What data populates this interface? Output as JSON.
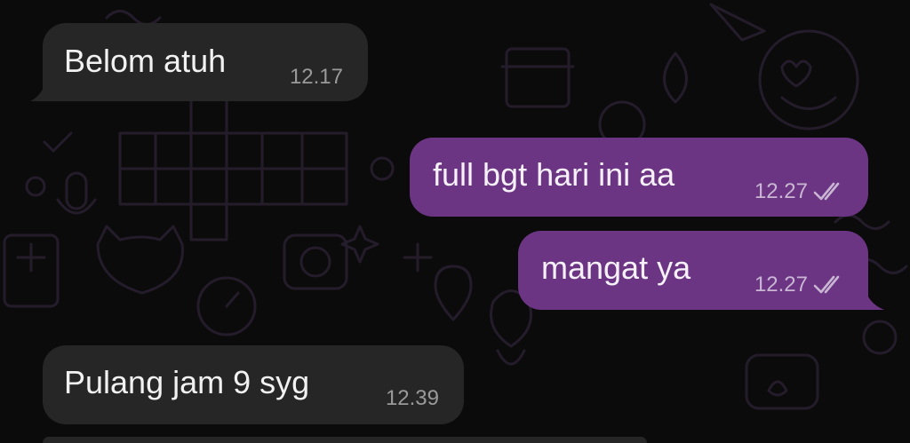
{
  "chat": {
    "messages": [
      {
        "direction": "incoming",
        "text": "Belom atuh",
        "time": "12.17"
      },
      {
        "direction": "outgoing",
        "text": "full bgt hari ini aa",
        "time": "12.27",
        "status_icon": "double-check-icon"
      },
      {
        "direction": "outgoing",
        "text": "mangat ya",
        "time": "12.27",
        "status_icon": "double-check-icon"
      },
      {
        "direction": "incoming",
        "text": "Pulang jam 9 syg",
        "time": "12.39"
      }
    ]
  },
  "colors": {
    "background": "#0b0b0b",
    "incoming_bubble": "#262626",
    "outgoing_bubble": "#6b3584",
    "doodle": "#3a2a44"
  }
}
